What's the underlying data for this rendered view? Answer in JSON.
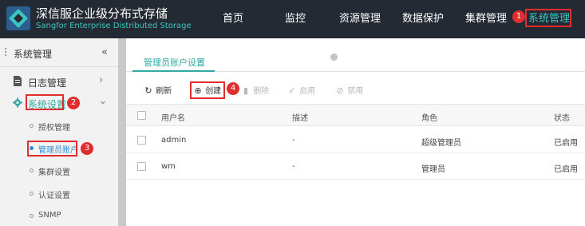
{
  "header": {
    "brand_cn": "深信服企业级分布式存储",
    "brand_en": "Sangfor Enterprise Distributed Storage",
    "nav": [
      {
        "label": "首页"
      },
      {
        "label": "监控"
      },
      {
        "label": "资源管理"
      },
      {
        "label": "数据保护"
      },
      {
        "label": "集群管理"
      },
      {
        "label": "系统管理",
        "active": true
      }
    ]
  },
  "sidebar": {
    "title": "系统管理",
    "collapse_icon": "double-chevron-left-icon",
    "groups": [
      {
        "label": "日志管理",
        "icon": "document-icon",
        "expanded": false
      },
      {
        "label": "系统设置",
        "icon": "gear-icon",
        "expanded": true
      }
    ],
    "sub_items": [
      {
        "label": "授权管理"
      },
      {
        "label": "管理员账户",
        "active": true
      },
      {
        "label": "集群设置"
      },
      {
        "label": "认证设置"
      },
      {
        "label": "SNMP"
      }
    ]
  },
  "main": {
    "tab": "管理员账户设置",
    "toolbar": {
      "refresh": "刷新",
      "create": "创建",
      "delete": "删除",
      "enable": "启用",
      "disable": "禁用"
    },
    "table": {
      "columns": [
        "用户名",
        "描述",
        "角色",
        "状态"
      ],
      "rows": [
        {
          "username": "admin",
          "description": "-",
          "role": "超级管理员",
          "status": "已启用"
        },
        {
          "username": "wm",
          "description": "-",
          "role": "管理员",
          "status": "已启用"
        }
      ]
    }
  },
  "annotations": {
    "step1": "1",
    "step2": "2",
    "step3": "3",
    "step4": "4"
  },
  "colors": {
    "topbar_bg": "#232a33",
    "accent_teal": "#2fa8a3",
    "highlight_red": "#e02e2e",
    "sidebar_bg": "#f2f2f2"
  }
}
